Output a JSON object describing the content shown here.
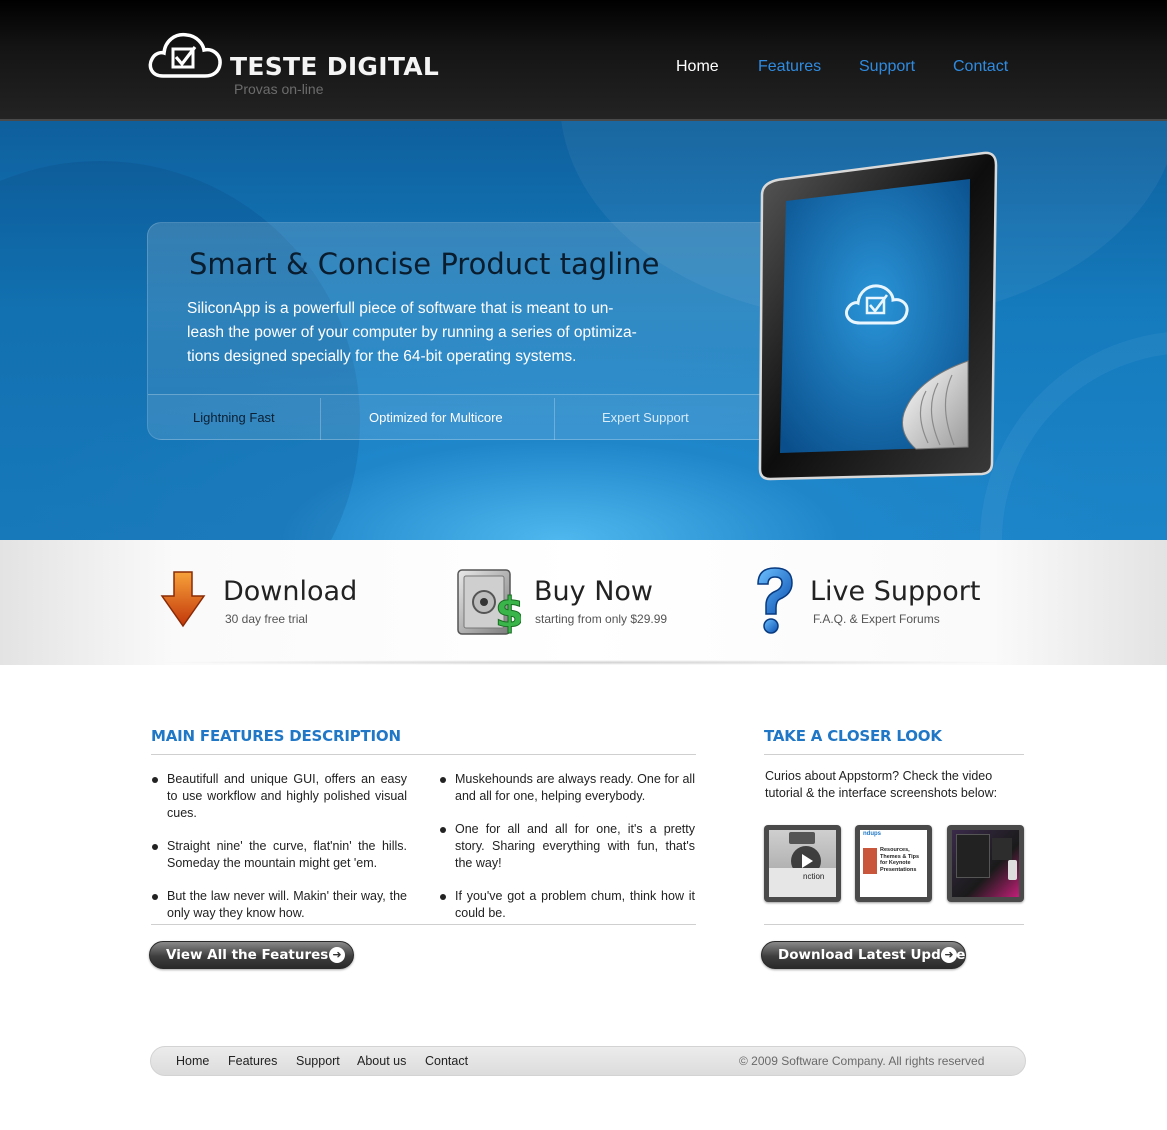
{
  "brand": {
    "title": "TESTE DIGITAL",
    "subtitle": "Provas on-line"
  },
  "nav": {
    "items": [
      {
        "label": "Home",
        "active": true
      },
      {
        "label": "Features",
        "active": false
      },
      {
        "label": "Support",
        "active": false
      },
      {
        "label": "Contact",
        "active": false
      }
    ]
  },
  "hero": {
    "tagline": "Smart & Concise Product tagline",
    "description": "SiliconApp is a powerfull piece of software that is meant to un-leash the power of your computer by running a series of optimiza-tions designed specially for the 64-bit operating systems.",
    "features": [
      "Lightning Fast",
      "Optimized for Multicore",
      "Expert Support"
    ]
  },
  "actions": [
    {
      "title": "Download",
      "subtitle": "30 day free trial",
      "icon": "download-arrow-icon"
    },
    {
      "title": "Buy Now",
      "subtitle": "starting from only $29.99",
      "icon": "safe-dollar-icon"
    },
    {
      "title": "Live Support",
      "subtitle": "F.A.Q. & Expert Forums",
      "icon": "question-mark-icon"
    }
  ],
  "main_features": {
    "title": "MAIN FEATURES DESCRIPTION",
    "left": [
      "Beautifull and unique GUI, offers an easy to use workflow and highly polished visual cues.",
      "Straight nine' the curve, flat'nin' the hills. Someday the mountain might get 'em.",
      "But the law never will. Makin' their way, the only way they know how."
    ],
    "right": [
      "Muskehounds are always ready. One for all and all for one, helping everybody.",
      "One for all and all for one, it's a pretty story. Sharing everything with fun, that's the way!",
      "If you've got a problem chum, think how it could be."
    ],
    "button": "View All the Features"
  },
  "closer_look": {
    "title": "TAKE A CLOSER LOOK",
    "text": "Curios about Appstorm? Check the video tutorial & the interface screenshots below:",
    "thumbs": [
      {
        "caption": "nction"
      },
      {
        "caption": "Resources, Themes & Tips for Keynote Presentations",
        "header": "ndups"
      },
      {
        "caption": ""
      }
    ],
    "button": "Download Latest Update"
  },
  "footer": {
    "links": [
      "Home",
      "Features",
      "Support",
      "About us",
      "Contact"
    ],
    "copyright": "© 2009 Software Company. All rights reserved"
  },
  "colors": {
    "accent": "#1f77c6",
    "nav_link": "#2f8be0",
    "hero_blue": "#1b84c8"
  }
}
